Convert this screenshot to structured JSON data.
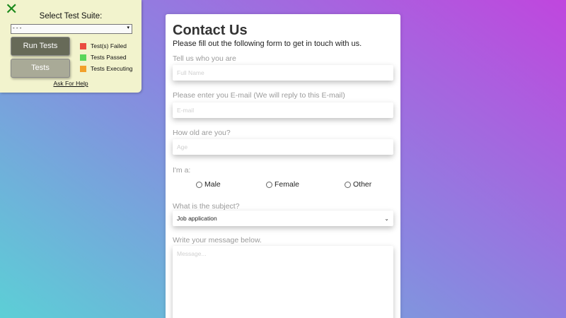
{
  "test_panel": {
    "close_icon": "close-x-icon",
    "title": "Select Test Suite:",
    "suite_select_value": "- - -",
    "run_button": "Run Tests",
    "tests_button": "Tests",
    "legend": [
      {
        "label": "Test(s) Failed",
        "color": "#ea4b3f"
      },
      {
        "label": "Tests Passed",
        "color": "#5ad65a"
      },
      {
        "label": "Tests Executing",
        "color": "#f2a02a"
      }
    ],
    "help_link": "Ask For Help"
  },
  "form": {
    "title": "Contact Us",
    "subtitle": "Please fill out the following form to get in touch with us.",
    "name_label": "Tell us who you are",
    "name_placeholder": "Full Name",
    "email_label": "Please enter you E-mail (We will reply to this E-mail)",
    "email_placeholder": "E-mail",
    "age_label": "How old are you?",
    "age_placeholder": "Age",
    "gender_label": "I'm a:",
    "gender_options": [
      "Male",
      "Female",
      "Other"
    ],
    "subject_label": "What is the subject?",
    "subject_value": "Job application",
    "message_label": "Write your message below.",
    "message_placeholder": "Message..."
  }
}
